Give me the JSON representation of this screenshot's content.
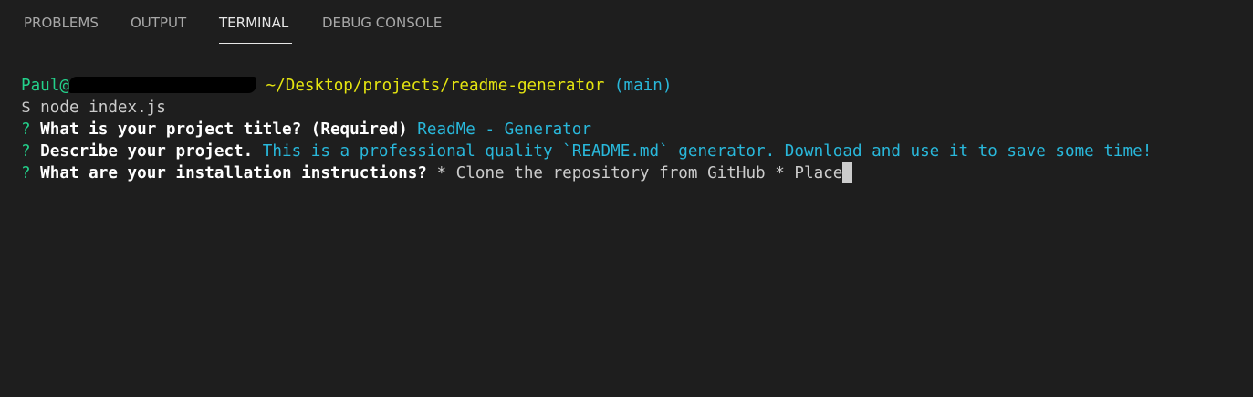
{
  "tabs": [
    {
      "label": "PROBLEMS"
    },
    {
      "label": "OUTPUT"
    },
    {
      "label": "TERMINAL"
    },
    {
      "label": "DEBUG CONSOLE"
    }
  ],
  "active_tab": "TERMINAL",
  "terminal": {
    "prompt_user": "Paul@",
    "prompt_path": " ~/Desktop/projects/readme-generator",
    "prompt_branch": " (main)",
    "command_line": "$ node index.js",
    "q1_mark": "?",
    "q1_text": " What is your project title? (Required)",
    "q1_answer": " ReadMe - Generator",
    "q2_mark": "?",
    "q2_text": " Describe your project.",
    "q2_answer": " This is a professional quality `README.md` generator. Download and use it to save some time!",
    "q3_mark": "?",
    "q3_text": " What are your installation instructions?",
    "q3_input": " * Clone the repository from GitHub * Place"
  },
  "colors": {
    "background": "#1e1e1e",
    "green": "#23d18b",
    "yellow": "#e5e510",
    "cyan": "#29b8db"
  }
}
